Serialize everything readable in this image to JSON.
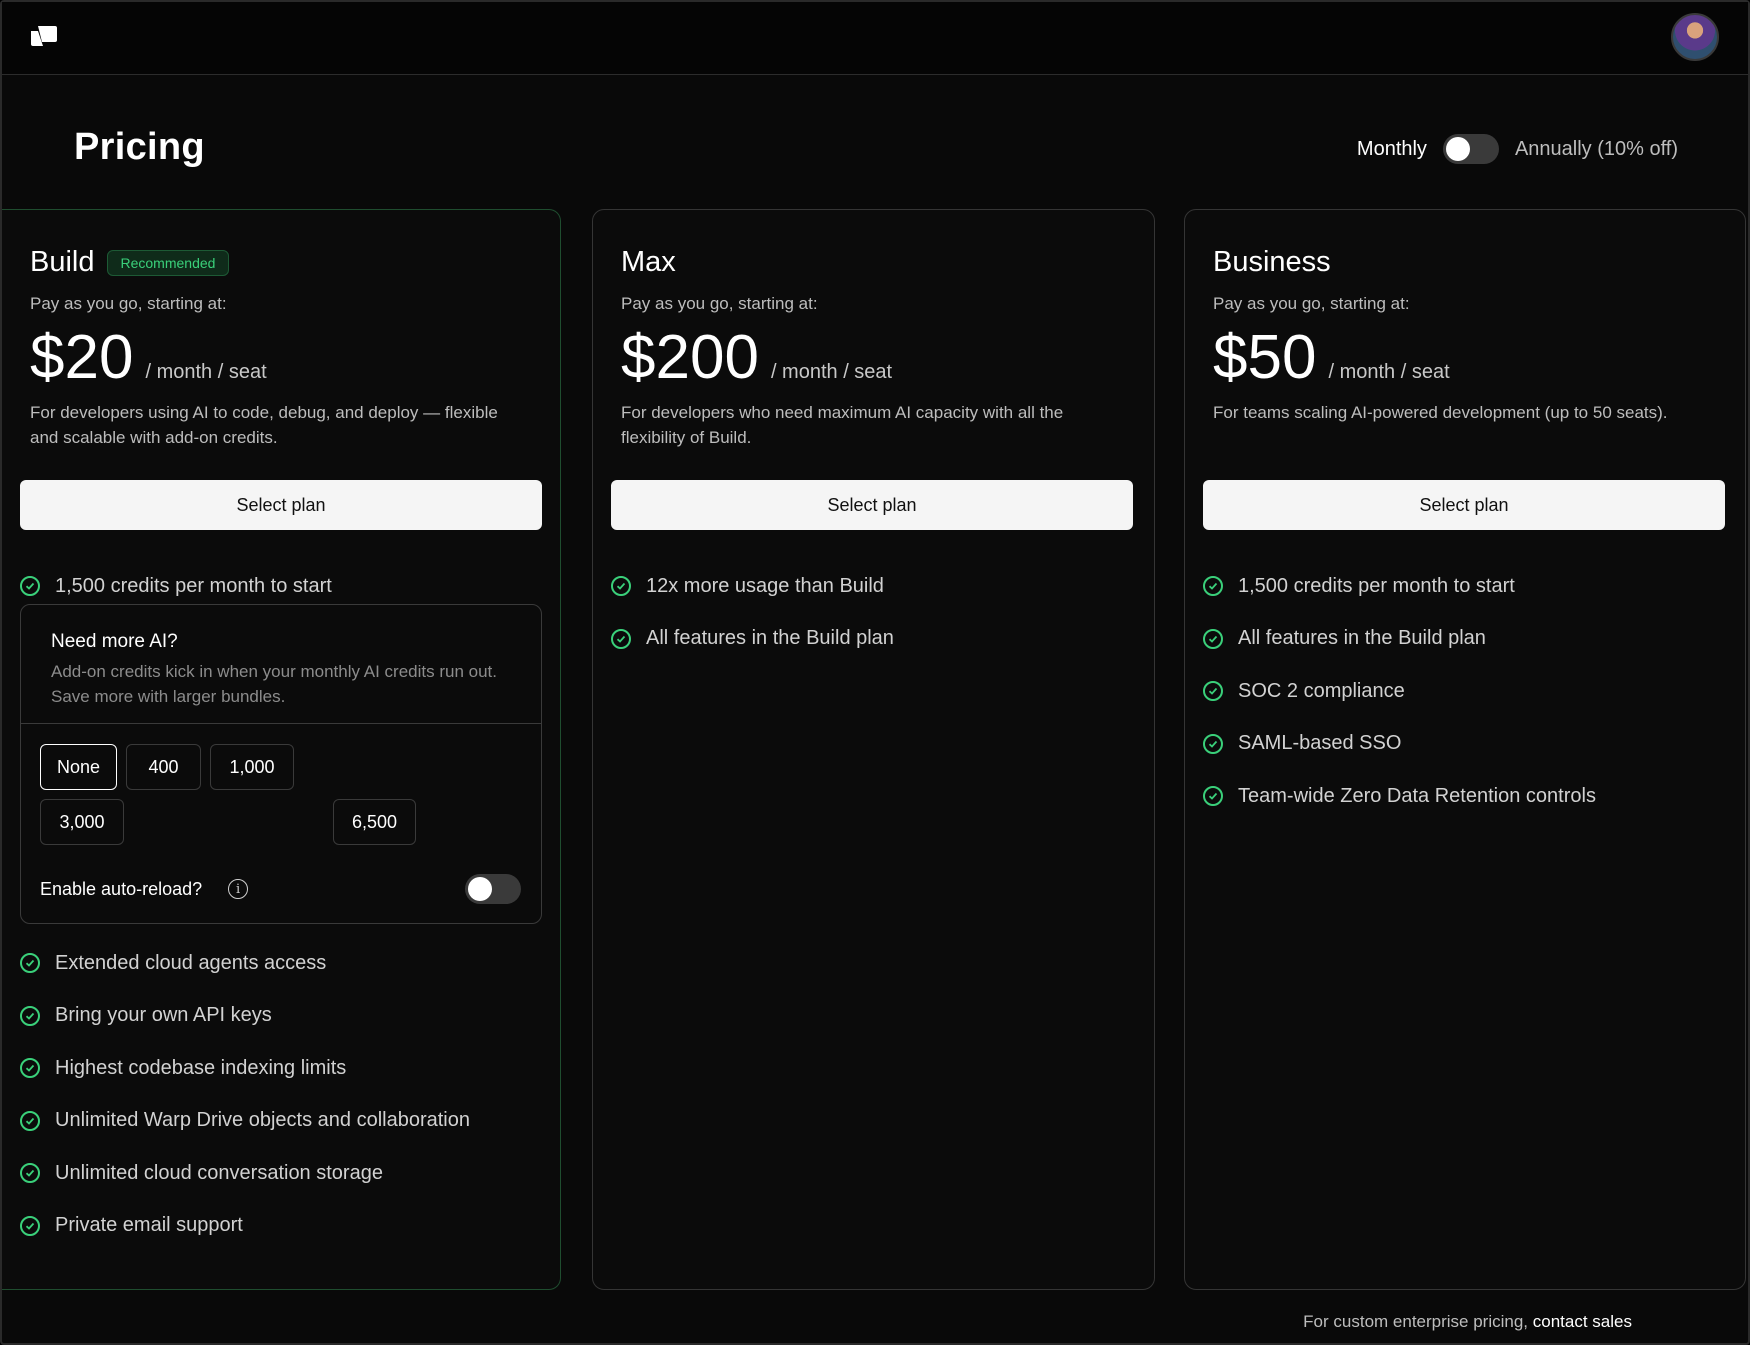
{
  "header": {
    "logo_icon": "warp-logo-icon",
    "avatar_icon": "user-avatar"
  },
  "page": {
    "title": "Pricing",
    "billing": {
      "monthly_label": "Monthly",
      "annual_label": "Annually (10% off)",
      "annual_selected": false
    }
  },
  "plans": [
    {
      "name": "Build",
      "badge": "Recommended",
      "subtitle": "Pay as you go, starting at:",
      "price": "$20",
      "per": "/ month / seat",
      "description": "For developers using AI to code, debug, and deploy — flexible and scalable with add-on credits.",
      "button": "Select plan",
      "features_top": [
        "1,500 credits per month to start"
      ],
      "addon": {
        "title": "Need more AI?",
        "description": "Add-on credits kick in when your monthly AI credits run out. Save more with larger bundles.",
        "bundles": [
          "None",
          "400",
          "1,000",
          "3,000",
          "6,500"
        ],
        "selected_bundle": "None",
        "autoreload_label": "Enable auto-reload?",
        "autoreload_enabled": false
      },
      "features": [
        "Extended cloud agents access",
        "Bring your own API keys",
        "Highest codebase indexing limits",
        "Unlimited Warp Drive objects and collaboration",
        "Unlimited cloud conversation storage",
        "Private email support"
      ]
    },
    {
      "name": "Max",
      "subtitle": "Pay as you go, starting at:",
      "price": "$200",
      "per": "/ month / seat",
      "description": "For developers who need maximum AI capacity with all the flexibility of Build.",
      "button": "Select plan",
      "features": [
        "12x more usage than Build",
        "All features in the Build plan"
      ]
    },
    {
      "name": "Business",
      "subtitle": "Pay as you go, starting at:",
      "price": "$50",
      "per": "/ month / seat",
      "description": "For teams scaling AI-powered development (up to 50 seats).",
      "button": "Select plan",
      "features": [
        "1,500 credits per month to start",
        "All features in the Build plan",
        "SOC 2 compliance",
        "SAML-based SSO",
        "Team-wide Zero Data Retention controls"
      ]
    }
  ],
  "footer": {
    "text": "For custom enterprise pricing, ",
    "link": "contact sales"
  },
  "colors": {
    "accent_green": "#3ad07a",
    "background": "#090909",
    "button_bg": "#f5f5f5"
  }
}
